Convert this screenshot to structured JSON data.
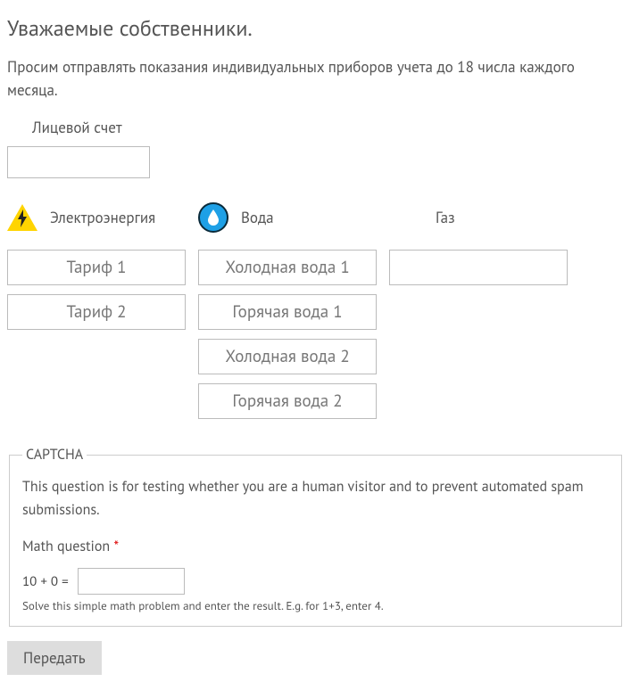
{
  "title": "Уважаемые собственники.",
  "intro": "Просим отправлять показания индивидуальных приборов учета до 18 числа каждого месяца.",
  "account": {
    "label": "Лицевой счет",
    "value": ""
  },
  "columns": {
    "electricity": {
      "label": "Электроэнергия",
      "inputs": [
        {
          "placeholder": "Тариф 1",
          "value": ""
        },
        {
          "placeholder": "Тариф 2",
          "value": ""
        }
      ]
    },
    "water": {
      "label": "Вода",
      "inputs": [
        {
          "placeholder": "Холодная вода 1",
          "value": ""
        },
        {
          "placeholder": "Горячая вода 1",
          "value": ""
        },
        {
          "placeholder": "Холодная вода 2",
          "value": ""
        },
        {
          "placeholder": "Горячая вода 2",
          "value": ""
        }
      ]
    },
    "gas": {
      "label": "Газ",
      "inputs": [
        {
          "placeholder": "",
          "value": ""
        }
      ]
    }
  },
  "captcha": {
    "legend": "CAPTCHA",
    "description": "This question is for testing whether you are a human visitor and to prevent automated spam submissions.",
    "math_label": "Math question",
    "required_mark": "*",
    "question": "10 + 0 =",
    "answer": "",
    "hint": "Solve this simple math problem and enter the result. E.g. for 1+3, enter 4."
  },
  "submit_label": "Передать"
}
